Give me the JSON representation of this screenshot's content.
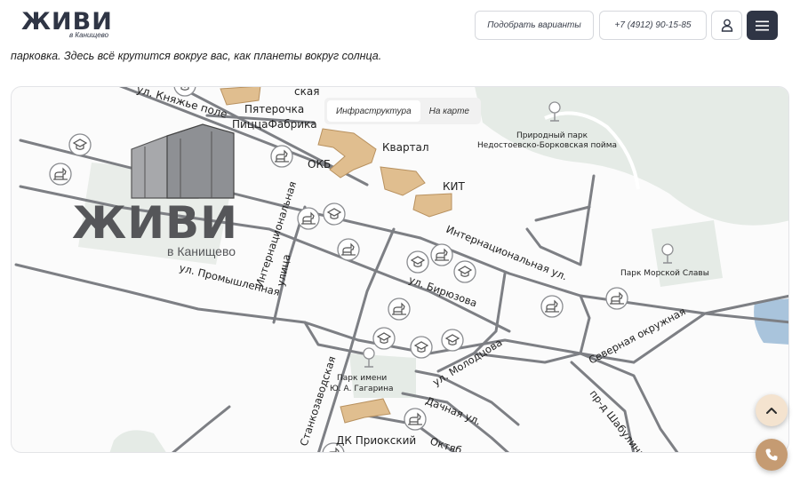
{
  "header": {
    "logo_main": "ЖИВИ",
    "logo_sub": "в Канищево",
    "pick_label": "Подобрать варианты",
    "phone": "+7 (4912) 90-15-85"
  },
  "intro": {
    "text": "парковка. Здесь всё крутится вокруг вас, как планеты вокруг солнца."
  },
  "map": {
    "tabs": [
      {
        "label": "Инфраструктура",
        "active": true
      },
      {
        "label": "На карте",
        "active": false
      }
    ],
    "labels": {
      "knyazhe": "ул. Княжье поле",
      "pyaterochka": "Пятерочка",
      "pizza": "ПиццаФабрика",
      "okb": "ОКБ",
      "kvartal": "Квартал",
      "kit": "КИТ",
      "park_nedost_1": "Природный парк",
      "park_nedost_2": "Недостоевско-Борковская пойма",
      "park_morskoy": "Парк Морской Славы",
      "internatsionalnaya_street": "Интернациональная",
      "ulitsa": "улица",
      "internatsionalnaya_ul": "Интернациональная ул.",
      "promyshlennaya": "ул. Промышленная",
      "biryuzova": "ул. Бирюзова",
      "molodtsova": "ул. Молодцова",
      "severnaya": "Северная окружная",
      "shabulina": "пр-д Шабулина",
      "stankozavodskaya": "Станкозаводская",
      "gagarin_1": "Парк имени",
      "gagarin_2": "Ю. А. Гагарина",
      "dachnaya": "Дачная ул.",
      "dk": "ДК Приокский",
      "oktyabr": "Октяб",
      "top_frag": "ская",
      "map_logo_main": "ЖИВИ",
      "map_logo_sub": "в Канищево"
    },
    "colors": {
      "park": "#e5ebe6",
      "water": "#a9c4dc",
      "road": "#7d7f84",
      "building": "#e0be8f",
      "building_edge": "#b8915f"
    }
  }
}
